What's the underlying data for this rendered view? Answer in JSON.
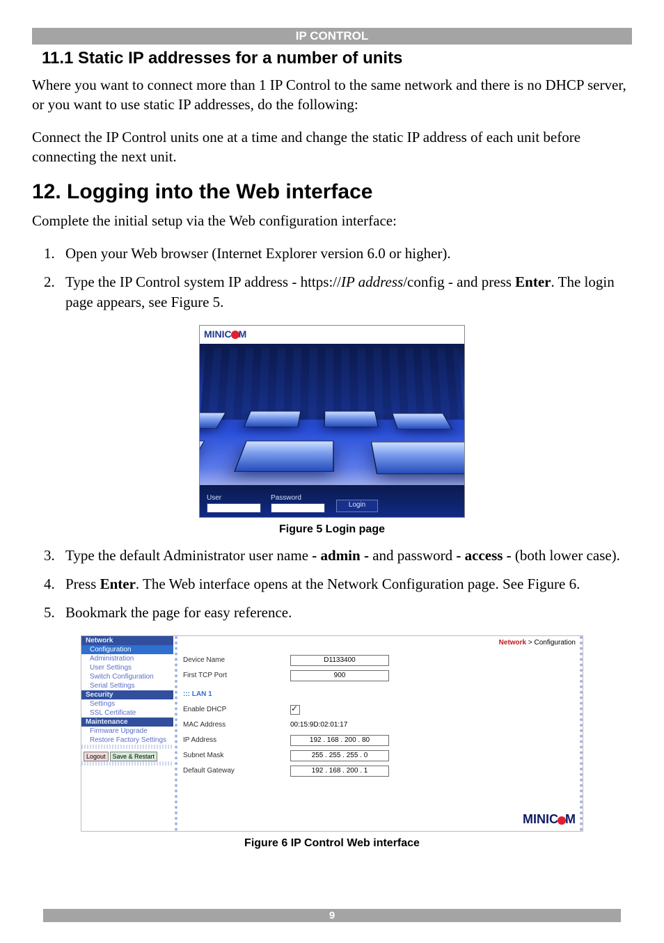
{
  "band": "IP CONTROL",
  "sec11": {
    "title": "11.1 Static IP addresses for a number of units",
    "p1": "Where you want to connect more than 1 IP Control to the same network and there is no DHCP server, or you want to use static IP addresses, do the following:",
    "p2": "Connect the IP Control units one at a time and change the static IP address of each unit before connecting the next unit."
  },
  "sec12": {
    "title": "12. Logging into the Web interface",
    "p1": "Complete the initial setup via the Web configuration interface:",
    "step1": "Open your Web browser (Internet Explorer version 6.0 or higher).",
    "step2_a": "Type the IP Control system IP address - https://",
    "step2_url_italic": "IP address",
    "step2_b": "/config - and press ",
    "step2_enter": "Enter",
    "step2_c": ". The login page appears, see Figure 5.",
    "fig5_cap": "Figure 5 Login page",
    "step3_a": "Type the default Administrator user name ",
    "step3_admin": "- admin -",
    "step3_b": " and password ",
    "step3_access": "- access -",
    "step3_c": " (both lower case).",
    "step4_a": "Press ",
    "step4_enter": "Enter",
    "step4_b": ". The Web interface opens at the Network Configuration page. See Figure 6.",
    "step5": "Bookmark the page for easy reference.",
    "fig6_cap": "Figure 6 IP Control Web interface"
  },
  "logo": {
    "pre": "MINIC",
    "post": "M"
  },
  "login": {
    "user_label": "User",
    "pass_label": "Password",
    "btn": "Login"
  },
  "nav": {
    "network": "Network",
    "configuration": "Configuration",
    "administration": "Administration",
    "user_settings": "User Settings",
    "switch_conf": "Switch Configuration",
    "serial": "Serial Settings",
    "security": "Security",
    "settings": "Settings",
    "ssl": "SSL Certificate",
    "maintenance": "Maintenance",
    "fw": "Firmware Upgrade",
    "rfs": "Restore Factory Settings",
    "logout": "Logout",
    "save": "Save & Restart"
  },
  "bc": {
    "nw": "Network",
    "sep": " > ",
    "cf": "Configuration"
  },
  "form": {
    "device_name_l": "Device Name",
    "device_name_v": "D1133400",
    "tcp_l": "First TCP Port",
    "tcp_v": "900",
    "lan": "::: LAN 1",
    "dhcp_l": "Enable DHCP",
    "mac_l": "MAC Address",
    "mac_v": "00:15:9D:02:01:17",
    "ip_l": "IP Address",
    "ip_v": "192 . 168 . 200 . 80",
    "sn_l": "Subnet Mask",
    "sn_v": "255 . 255 . 255 .   0",
    "gw_l": "Default Gateway",
    "gw_v": "192 . 168 . 200 .   1"
  },
  "page_number": "9"
}
